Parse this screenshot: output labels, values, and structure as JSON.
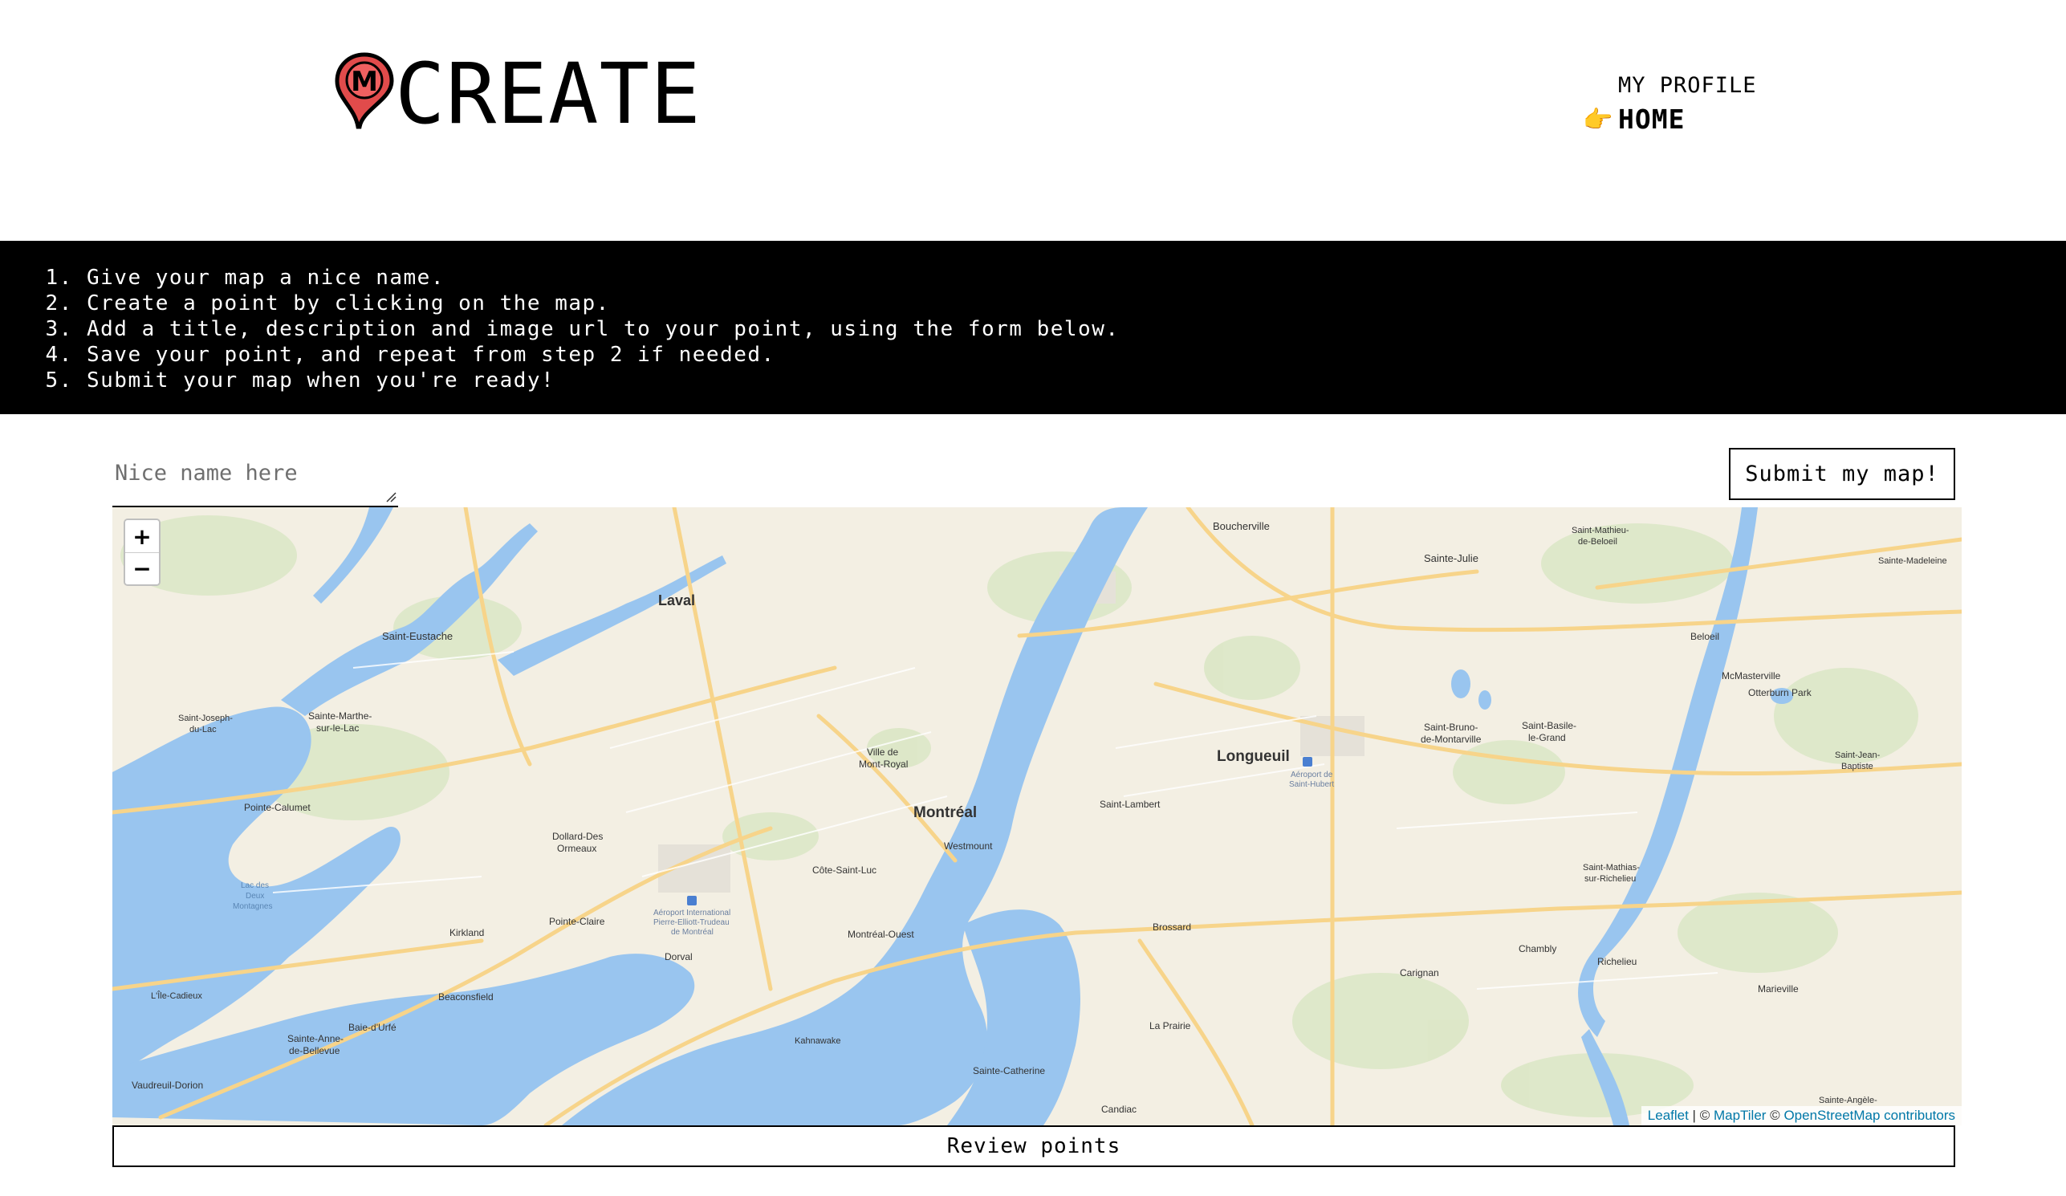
{
  "header": {
    "brand_title": "CREATE",
    "logo_letter": "M",
    "nav": [
      {
        "label": "MY PROFILE",
        "active": false
      },
      {
        "label": "HOME",
        "active": true
      }
    ]
  },
  "instructions": [
    "Give your map a nice name.",
    "Create a point by clicking on the map.",
    "Add a title, description and image url to your point, using the form below.",
    "Save your point, and repeat from step 2 if needed.",
    "Submit your map when you're ready!"
  ],
  "form": {
    "name_placeholder": "Nice name here",
    "submit_label": "Submit my map!",
    "review_label": "Review points"
  },
  "map": {
    "zoom_in": "+",
    "zoom_out": "−",
    "attribution": {
      "leaflet": "Leaflet",
      "separator": " | © ",
      "maptiler": "MapTiler",
      "copy": " © ",
      "osm": "OpenStreetMap contributors"
    },
    "labels": {
      "laval": "Laval",
      "montreal": "Montréal",
      "longueuil": "Longueuil",
      "saint_eustache": "Saint-Eustache",
      "boucherville": "Boucherville",
      "sainte_julie": "Sainte-Julie",
      "beloeil": "Beloeil",
      "mcmasterville": "McMasterville",
      "otterburn_park": "Otterburn Park",
      "brossard": "Brossard",
      "saint_lambert": "Saint-Lambert",
      "chambly": "Chambly",
      "richelieu": "Richelieu",
      "carignan": "Carignan",
      "marieville": "Marieville",
      "la_prairie": "La Prairie",
      "candiac": "Candiac",
      "sainte_catherine": "Sainte-Catherine",
      "kahnawake": "Kahnawake",
      "dorval": "Dorval",
      "kirkland": "Kirkland",
      "pointe_claire": "Pointe-Claire",
      "beaconsfield": "Beaconsfield",
      "baie_durfe": "Baie-d'Urfé",
      "vaudreuil_dorion": "Vaudreuil-Dorion",
      "pointe_calumet": "Pointe-Calumet",
      "westmount": "Westmount",
      "cote_saint_luc": "Côte-Saint-Luc",
      "montreal_ouest": "Montréal-Ouest",
      "ville_mont_royal": "Ville de",
      "ville_mont_royal_2": "Mont-Royal",
      "dollard": "Dollard-Des",
      "dollard_2": "Ormeaux",
      "sainte_marthe": "Sainte-Marthe-",
      "sainte_marthe_2": "sur-le-Lac",
      "saint_joseph": "Saint-Joseph-",
      "saint_joseph_2": "du-Lac",
      "saint_bruno": "Saint-Bruno-",
      "saint_bruno_2": "de-Montarville",
      "saint_basile": "Saint-Basile-",
      "saint_basile_2": "le-Grand",
      "saint_mathieu": "Saint-Mathieu-",
      "saint_mathieu_2": "de-Beloeil",
      "sainte_madeleine": "Sainte-Madeleine",
      "saint_jean_baptiste": "Saint-Jean-",
      "saint_jean_baptiste_2": "Baptiste",
      "saint_mathias": "Saint-Mathias-",
      "saint_mathias_2": "sur-Richelieu",
      "sainte_anne": "Sainte-Anne-",
      "sainte_anne_2": "de-Bellevue",
      "lile_cadieux": "L'Île-Cadieux",
      "lac_deux_montagnes": "Lac des",
      "lac_deux_montagnes_2": "Deux",
      "lac_deux_montagnes_3": "Montagnes",
      "airport_mtl": "Aéroport International",
      "airport_mtl_2": "Pierre-Elliott-Trudeau",
      "airport_mtl_3": "de Montréal",
      "airport_sh": "Aéroport de",
      "airport_sh_2": "Saint-Hubert",
      "sainte_angele": "Sainte-Angèle-"
    }
  }
}
